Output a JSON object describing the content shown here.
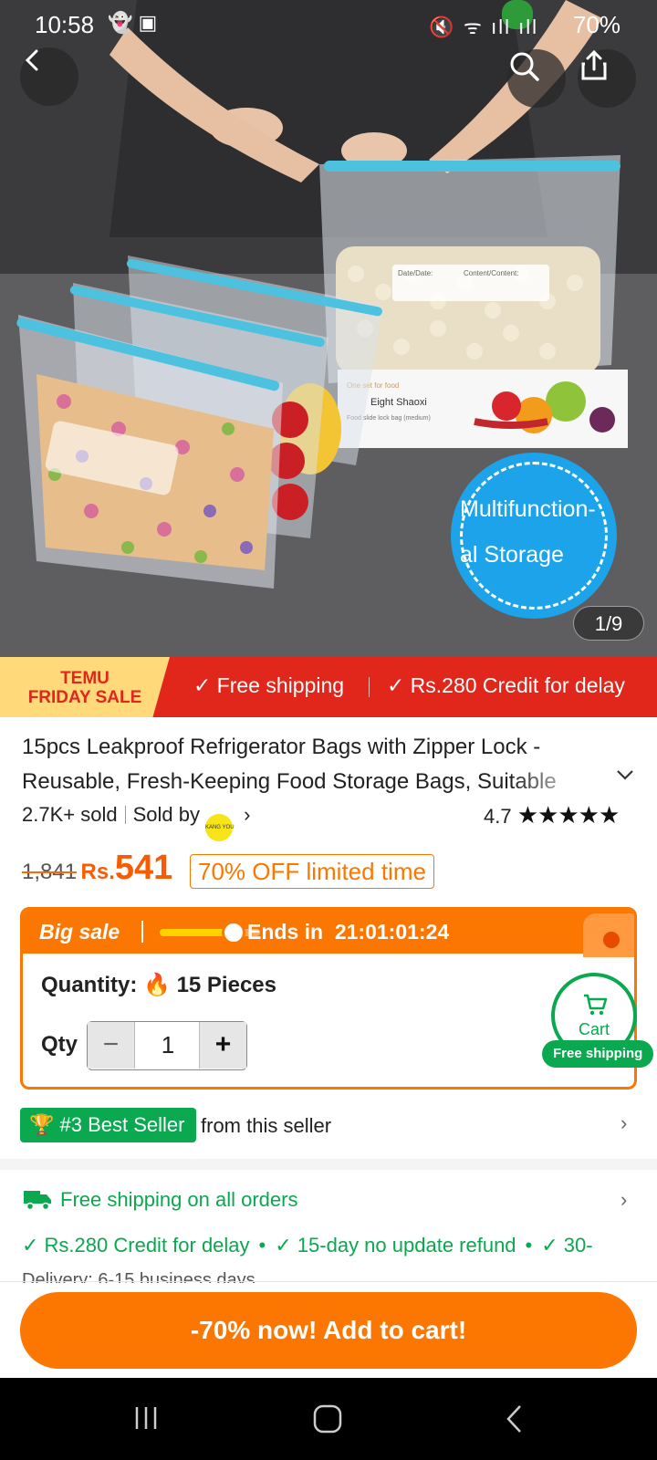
{
  "status_bar": {
    "time": "10:58",
    "battery": "70%"
  },
  "hero": {
    "bag_labels": [
      "Date/Date:",
      "Content/Content:"
    ],
    "box_text": [
      "One set for food",
      "Eight Shaoxi",
      "Food slide lock bag (medium)"
    ],
    "badge_line1": "Multifunction-",
    "badge_line2": "al Storage",
    "counter": "1/9"
  },
  "promo": {
    "sale_line1": "TEMU",
    "sale_line2": "FRIDAY SALE",
    "free_shipping": "Free shipping",
    "credit": "Rs.280 Credit for delay"
  },
  "product": {
    "title": "15pcs Leakproof Refrigerator Bags with Zipper Lock - Reusable, Fresh-Keeping Food Storage Bags, Suitable",
    "sold": "2.7K+ sold",
    "sold_by": "Sold by",
    "seller_logo_text": "KANG YOU",
    "rating": "4.7",
    "rating_value": 4.7,
    "old_price": "1,841",
    "currency": "Rs.",
    "price": "541",
    "discount": "70% OFF limited time"
  },
  "big_sale": {
    "label": "Big sale",
    "progress": 0.75,
    "ends_label": "Ends in",
    "countdown": "21:01:01:24",
    "quantity_label": "Quantity:",
    "quantity_value": "15 Pieces",
    "qty_label": "Qty",
    "qty_value": "1"
  },
  "cart": {
    "label": "Cart",
    "free_shipping": "Free shipping"
  },
  "best_seller": {
    "badge": "#3 Best Seller",
    "from": "from this seller"
  },
  "shipping": {
    "title": "Free shipping on all orders",
    "checks": [
      "Rs.280 Credit for delay",
      "15-day no update refund",
      "30-"
    ],
    "delivery": "Delivery: 6-15 business days"
  },
  "cta": {
    "label": "-70% now! Add to cart!"
  },
  "colors": {
    "accent": "#fb7701",
    "promo_red": "#e1261c",
    "green": "#0aa84f"
  }
}
